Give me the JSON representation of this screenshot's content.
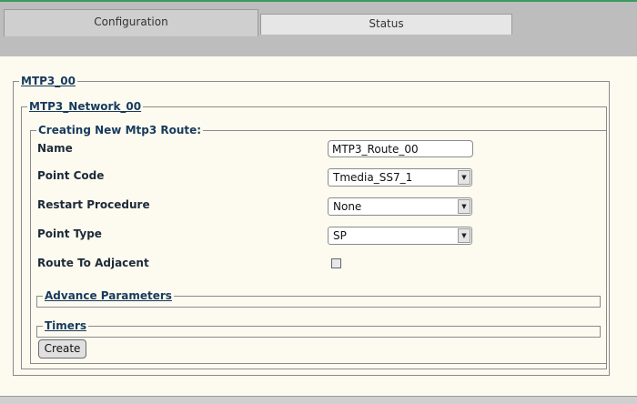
{
  "tabs": [
    {
      "label": "Configuration",
      "active": true
    },
    {
      "label": "Status",
      "active": false
    }
  ],
  "sections": {
    "mtp3": "MTP3_00",
    "network": "MTP3_Network_00",
    "route_form": "Creating New Mtp3 Route:",
    "advance": "Advance Parameters",
    "timers": "Timers"
  },
  "fields": {
    "name": {
      "label": "Name",
      "value": "MTP3_Route_00"
    },
    "point_code": {
      "label": "Point Code",
      "value": "Tmedia_SS7_1"
    },
    "restart_procedure": {
      "label": "Restart Procedure",
      "value": "None"
    },
    "point_type": {
      "label": "Point Type",
      "value": "SP"
    },
    "route_to_adjacent": {
      "label": "Route To Adjacent",
      "checked": false
    }
  },
  "buttons": {
    "create": "Create"
  },
  "icons": {
    "dropdown": "chevron-down-icon",
    "checkbox": "checkbox-icon"
  },
  "colors": {
    "accent": "#3c9a5f",
    "legend": "#173a5e",
    "background": "#fdfbf0"
  }
}
